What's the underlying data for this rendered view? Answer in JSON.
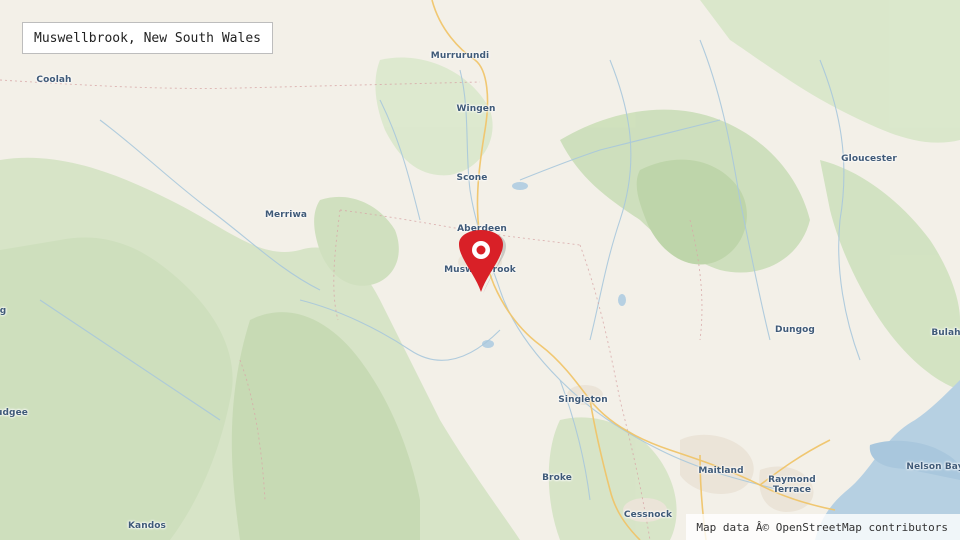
{
  "location_box": {
    "text": "Muswellbrook, New South Wales"
  },
  "attribution": {
    "text": "Map data Â© OpenStreetMap contributors"
  },
  "marker": {
    "icon": "map-pin-icon",
    "color": "#d92027"
  },
  "places": [
    {
      "id": "murrurundi",
      "label": "Murrurundi"
    },
    {
      "id": "coolah",
      "label": "Coolah"
    },
    {
      "id": "wingen",
      "label": "Wingen"
    },
    {
      "id": "scone",
      "label": "Scone"
    },
    {
      "id": "gloucester",
      "label": "Gloucester"
    },
    {
      "id": "merriwa",
      "label": "Merriwa"
    },
    {
      "id": "aberdeen",
      "label": "Aberdeen"
    },
    {
      "id": "muswellbrook",
      "label": "Muswellbrook"
    },
    {
      "id": "dungog",
      "label": "Dungog"
    },
    {
      "id": "bulah",
      "label": "Bulah"
    },
    {
      "id": "west-edge",
      "label": "g"
    },
    {
      "id": "singleton",
      "label": "Singleton"
    },
    {
      "id": "mudgee",
      "label": "udgee"
    },
    {
      "id": "nelson-bay",
      "label": "Nelson Bay"
    },
    {
      "id": "maitland",
      "label": "Maitland"
    },
    {
      "id": "raymond-terrace-1",
      "label": "Raymond"
    },
    {
      "id": "raymond-terrace-2",
      "label": "Terrace"
    },
    {
      "id": "broke",
      "label": "Broke"
    },
    {
      "id": "kandos",
      "label": "Kandos"
    },
    {
      "id": "cessnock",
      "label": "Cessnock"
    }
  ],
  "colors": {
    "land": "#f3f0e8",
    "forest": "#d4e3c4",
    "forest_dark": "#c3d8b1",
    "water": "#b6d0e2",
    "river": "#a9c8dc",
    "road": "#f2c86a",
    "urban": "#ece6dc",
    "label": "#3f5a78"
  }
}
